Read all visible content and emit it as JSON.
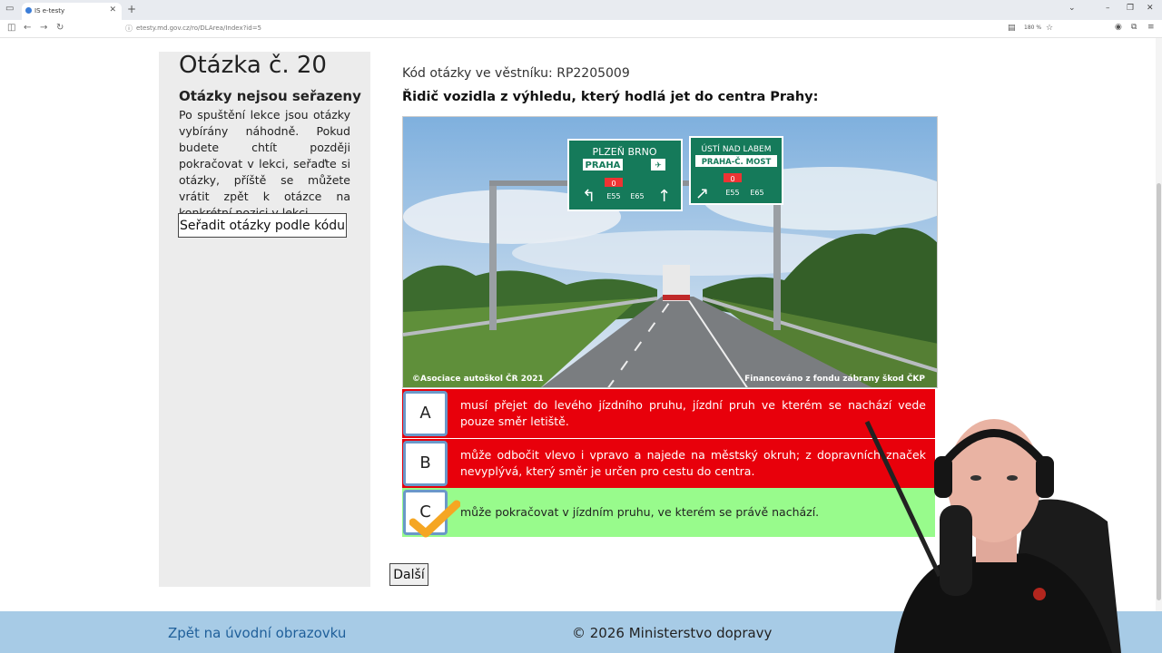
{
  "browser": {
    "tab_title": "IS e-testy",
    "url": "etesty.md.gov.cz/ro/DLArea/Index?id=5",
    "zoom": "180 %"
  },
  "sidebar": {
    "question_title": "Otázka č. 20",
    "heading": "Otázky nejsou seřazeny",
    "paragraph": "Po spuštění lekce jsou otázky vybírány náhodně. Pokud budete chtít později pokračovat v lekci, seřaďte si otázky, příště se můžete vrátit zpět k otázce na konkrétní pozici v lekci.",
    "sort_button": "Seřadit otázky podle kódu"
  },
  "main": {
    "code_label": "Kód otázky ve věstníku: RP2205009",
    "question": "Řidič vozidla z výhledu, který hodlá jet do centra Prahy:",
    "photo": {
      "caption_left": "©Asociace autoškol ČR 2021",
      "caption_right": "Financováno z fondu zábrany škod ČKP",
      "sign_left_top": "PLZEŇ  BRNO",
      "sign_left_mid": "PRAHA",
      "sign_right_top": "ÚSTÍ NAD LABEM",
      "sign_right_mid": "PRAHA-Č. MOST",
      "route_0": "0",
      "route_e55": "E55",
      "route_e65": "E65"
    },
    "answers": [
      {
        "letter": "A",
        "text": "musí přejet do levého jízdního pruhu, jízdní pruh ve kterém se nachází vede pouze směr letiště.",
        "state": "wrong"
      },
      {
        "letter": "B",
        "text": "může odbočit vlevo i vpravo a najede na městský okruh; z dopravních značek nevyplývá, který směr je určen pro cestu do centra.",
        "state": "wrong"
      },
      {
        "letter": "C",
        "text": "může pokračovat v jízdním pruhu, ve kterém se právě nachází.",
        "state": "correct"
      }
    ],
    "next_button": "Další"
  },
  "footer": {
    "back_link": "Zpět na úvodní obrazovku",
    "copyright": "© 2026 Ministerstvo dopravy"
  },
  "colors": {
    "wrong": "#e8000b",
    "correct": "#98fb8c",
    "sidebar": "#ececec",
    "footer": "#a7cbe6",
    "link": "#1f5f9a",
    "check": "#f5a623"
  }
}
